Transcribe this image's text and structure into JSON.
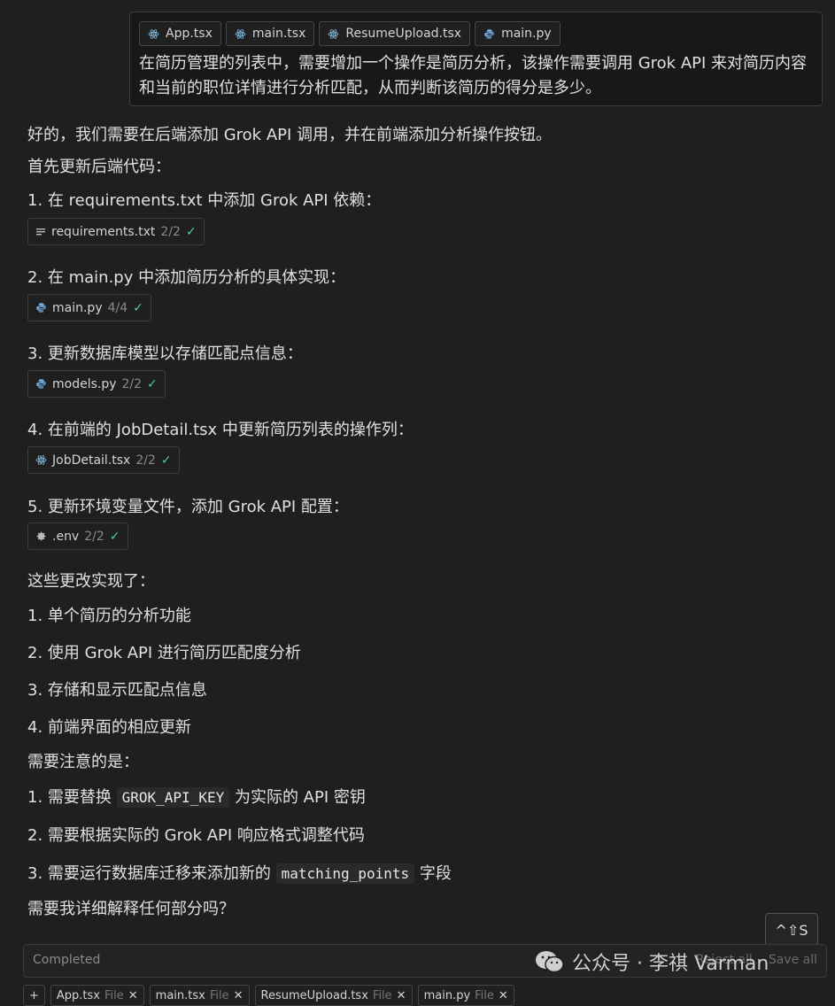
{
  "user_message": {
    "chips": [
      {
        "icon": "react-icon",
        "label": "App.tsx"
      },
      {
        "icon": "react-icon",
        "label": "main.tsx"
      },
      {
        "icon": "react-icon",
        "label": "ResumeUpload.tsx"
      },
      {
        "icon": "python-icon",
        "label": "main.py"
      }
    ],
    "text": "在简历管理的列表中，需要增加一个操作是简历分析，该操作需要调用 Grok API 来对简历内容和当前的职位详情进行分析匹配，从而判断该简历的得分是多少。"
  },
  "response": {
    "intro": "好的，我们需要在后端添加 Grok API 调用，并在前端添加分析操作按钮。",
    "first_backend": "首先更新后端代码：",
    "steps": [
      {
        "text": "1. 在 requirements.txt 中添加 Grok API 依赖：",
        "file": "requirements.txt",
        "count": "2/2",
        "icon": "lines-icon"
      },
      {
        "text": "2. 在 main.py 中添加简历分析的具体实现：",
        "file": "main.py",
        "count": "4/4",
        "icon": "python-icon"
      },
      {
        "text": "3. 更新数据库模型以存储匹配点信息：",
        "file": "models.py",
        "count": "2/2",
        "icon": "python-icon"
      },
      {
        "text": "4. 在前端的 JobDetail.tsx 中更新简历列表的操作列：",
        "file": "JobDetail.tsx",
        "count": "2/2",
        "icon": "react-icon"
      },
      {
        "text": "5. 更新环境变量文件，添加 Grok API 配置：",
        "file": ".env",
        "count": "2/2",
        "icon": "gear-icon"
      }
    ],
    "summary_title": "这些更改实现了：",
    "summary": [
      "1. 单个简历的分析功能",
      "2. 使用 Grok API 进行简历匹配度分析",
      "3. 存储和显示匹配点信息",
      "4. 前端界面的相应更新"
    ],
    "notes_title": "需要注意的是：",
    "notes": [
      {
        "before": "1. 需要替换 ",
        "code": "GROK_API_KEY",
        "after": " 为实际的 API 密钥"
      },
      {
        "before": "2. 需要根据实际的 Grok API 响应格式调整代码",
        "code": "",
        "after": ""
      },
      {
        "before": "3. 需要运行数据库迁移来添加新的 ",
        "code": "matching_points",
        "after": " 字段"
      }
    ],
    "closing": "需要我详细解释任何部分吗？"
  },
  "tooltip": "^⇧S",
  "status": {
    "text": "Completed",
    "actions": [
      "Reject all",
      "Save all"
    ]
  },
  "watermark": "公众号 · 李祺 Varman",
  "bottom_chips": [
    {
      "label": "+"
    },
    {
      "label": "App.tsx",
      "suffix": "File"
    },
    {
      "label": "main.tsx",
      "suffix": "File"
    },
    {
      "label": "ResumeUpload.tsx",
      "suffix": "File"
    },
    {
      "label": "main.py",
      "suffix": "File"
    }
  ]
}
